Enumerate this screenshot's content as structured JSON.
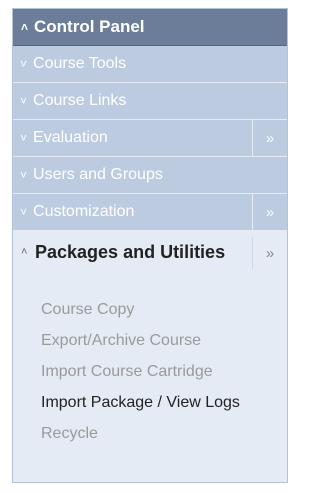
{
  "header": {
    "title": "Control Panel",
    "chevron_icon": "double-chevron-up-icon"
  },
  "rows": [
    {
      "label": "Course Tools",
      "has_more": false
    },
    {
      "label": "Course Links",
      "has_more": false
    },
    {
      "label": "Evaluation",
      "has_more": true
    },
    {
      "label": "Users and Groups",
      "has_more": false
    },
    {
      "label": "Customization",
      "has_more": true
    }
  ],
  "section": {
    "title": "Packages and Utilities",
    "links": [
      {
        "label": "Course Copy",
        "active": false
      },
      {
        "label": "Export/Archive Course",
        "active": false
      },
      {
        "label": "Import Course Cartridge",
        "active": false
      },
      {
        "label": "Import Package / View Logs",
        "active": true
      },
      {
        "label": "Recycle",
        "active": false
      }
    ]
  },
  "glyphs": {
    "down": "»",
    "up": "«",
    "more": "»"
  }
}
